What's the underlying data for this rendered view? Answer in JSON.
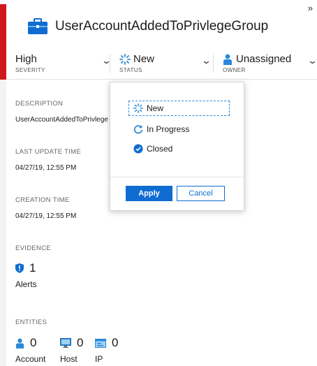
{
  "header": {
    "title": "UserAccountAddedToPrivlegeGroup",
    "expand_glyph": "»",
    "severity": {
      "value": "High",
      "label": "SEVERITY"
    },
    "status": {
      "value": "New",
      "label": "STATUS"
    },
    "owner": {
      "value": "Unassigned",
      "label": "OWNER"
    }
  },
  "details": {
    "description_label": "DESCRIPTION",
    "description_value": "UserAccountAddedToPrivlege",
    "last_update_label": "LAST UPDATE TIME",
    "last_update_value": "04/27/19, 12:55 PM",
    "creation_label": "CREATION TIME",
    "creation_value": "04/27/19, 12:55 PM",
    "evidence_label": "EVIDENCE",
    "alerts_count": "1",
    "alerts_label": "Alerts",
    "entities_label": "ENTITIES",
    "account_count": "0",
    "account_label": "Account",
    "host_count": "0",
    "host_label": "Host",
    "ip_count": "0",
    "ip_label": "IP"
  },
  "status_dropdown": {
    "options": [
      "New",
      "In Progress",
      "Closed"
    ],
    "selected": "New",
    "apply_label": "Apply",
    "cancel_label": "Cancel"
  },
  "colors": {
    "severity_bar": "#d0191f",
    "accent": "#0f6cd1",
    "icon_blue": "#2b88d8"
  },
  "icons": [
    "briefcase-icon",
    "spinner-icon",
    "chevron-down-icon",
    "user-icon",
    "refresh-icon",
    "check-circle-icon",
    "shield-icon",
    "host-icon",
    "ip-icon"
  ]
}
